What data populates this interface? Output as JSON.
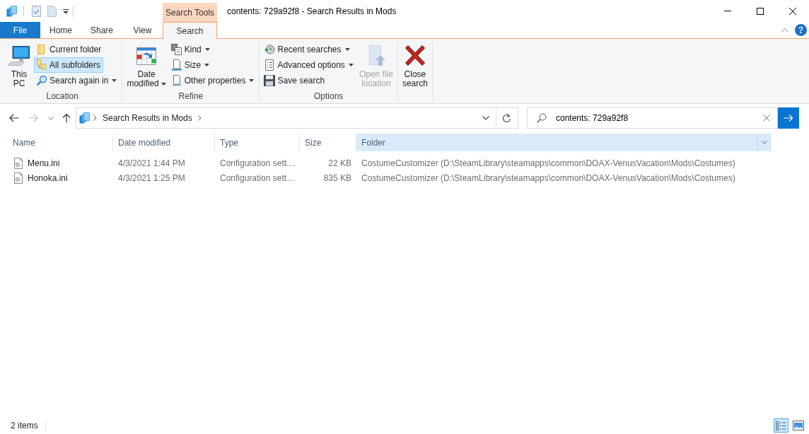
{
  "window": {
    "title": "contents: 729a92f8 - Search Results in Mods",
    "context_header": "Search Tools"
  },
  "ribbon_tabs": [
    {
      "label": "File",
      "kind": "file",
      "selected": false
    },
    {
      "label": "Home",
      "kind": "tab",
      "selected": false
    },
    {
      "label": "Share",
      "kind": "tab",
      "selected": false
    },
    {
      "label": "View",
      "kind": "tab",
      "selected": false
    },
    {
      "label": "Search",
      "kind": "contextual",
      "selected": true
    }
  ],
  "ribbon_groups": [
    {
      "label": "Location",
      "controls": [
        {
          "kind": "large",
          "label": "This\nPC",
          "dropdown": false,
          "disabled": false
        },
        {
          "kind": "stack",
          "items": [
            {
              "label": "Current folder",
              "dropdown": false,
              "selected": false
            },
            {
              "label": "All subfolders",
              "dropdown": false,
              "selected": true
            },
            {
              "label": "Search again in",
              "dropdown": true,
              "selected": false
            }
          ]
        }
      ]
    },
    {
      "label": "Refine",
      "controls": [
        {
          "kind": "large",
          "label": "Date\nmodified",
          "dropdown": true,
          "disabled": false
        },
        {
          "kind": "stack",
          "items": [
            {
              "label": "Kind",
              "dropdown": true,
              "selected": false
            },
            {
              "label": "Size",
              "dropdown": true,
              "selected": false
            },
            {
              "label": "Other properties",
              "dropdown": true,
              "selected": false
            }
          ]
        }
      ]
    },
    {
      "label": "Options",
      "controls": [
        {
          "kind": "stack",
          "items": [
            {
              "label": "Recent searches",
              "dropdown": true,
              "selected": false
            },
            {
              "label": "Advanced options",
              "dropdown": true,
              "selected": false
            },
            {
              "label": "Save search",
              "dropdown": false,
              "selected": false
            }
          ]
        },
        {
          "kind": "large",
          "label": "Open file\nlocation",
          "dropdown": false,
          "disabled": true
        }
      ]
    },
    {
      "controls": [
        {
          "kind": "large",
          "label": "Close\nsearch",
          "dropdown": false,
          "disabled": false
        }
      ]
    }
  ],
  "navigation": [
    {
      "kind": "back",
      "disabled": false
    },
    {
      "kind": "forward",
      "disabled": true
    },
    {
      "kind": "recent",
      "disabled": false
    },
    {
      "kind": "up",
      "disabled": false
    }
  ],
  "address": {
    "segments": [
      "Search Results in Mods"
    ]
  },
  "search": {
    "value": "contents: 729a92f8"
  },
  "columns": [
    {
      "label": "Name",
      "highlighted": false
    },
    {
      "label": "Date modified",
      "highlighted": false
    },
    {
      "label": "Type",
      "highlighted": false
    },
    {
      "label": "Size",
      "highlighted": false
    },
    {
      "label": "Folder",
      "highlighted": true
    }
  ],
  "rows": [
    {
      "name": "Menu.ini",
      "date_modified": "4/3/2021 1:44 PM",
      "type": "Configuration sett…",
      "size": "22 KB",
      "folder": "CostumeCustomizer (D:\\SteamLibrary\\steamapps\\common\\DOAX-VenusVacation\\Mods\\Costumes)"
    },
    {
      "name": "Honoka.ini",
      "date_modified": "4/3/2021 1:25 PM",
      "type": "Configuration sett…",
      "size": "835 KB",
      "folder": "CostumeCustomizer (D:\\SteamLibrary\\steamapps\\common\\DOAX-VenusVacation\\Mods\\Costumes)"
    }
  ],
  "status_bar": {
    "text": "2 items",
    "views": [
      {
        "kind": "details",
        "selected": true
      },
      {
        "kind": "large_icons",
        "selected": false
      }
    ]
  }
}
